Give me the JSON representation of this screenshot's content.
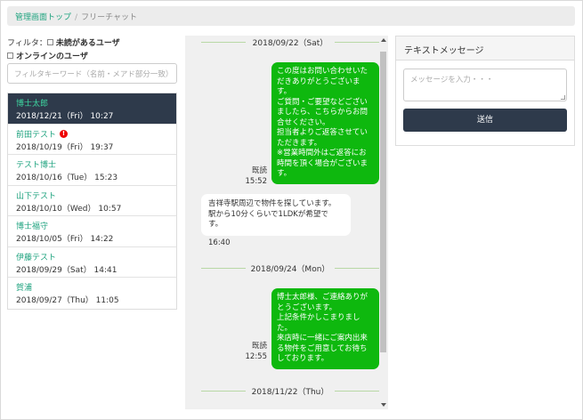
{
  "breadcrumb": {
    "home": "管理画面トップ",
    "separator": "/",
    "current": "フリーチャット"
  },
  "filter": {
    "label": "フィルタ：",
    "unread_label": "未読があるユーザ",
    "online_label": "オンラインのユーザ",
    "search_placeholder": "フィルタキーワード（名前・メアド部分一致）"
  },
  "users": [
    {
      "name": "博士太郎",
      "time": "2018/12/21（Fri） 10:27",
      "active": true,
      "unread": ""
    },
    {
      "name": "前田テスト",
      "time": "2018/10/19（Fri） 19:37",
      "active": false,
      "unread": "!"
    },
    {
      "name": "テスト博士",
      "time": "2018/10/16（Tue） 15:23",
      "active": false,
      "unread": ""
    },
    {
      "name": "山下テスト",
      "time": "2018/10/10（Wed） 10:57",
      "active": false,
      "unread": ""
    },
    {
      "name": "博士福守",
      "time": "2018/10/05（Fri） 14:22",
      "active": false,
      "unread": ""
    },
    {
      "name": "伊藤テスト",
      "time": "2018/09/29（Sat） 14:41",
      "active": false,
      "unread": ""
    },
    {
      "name": "賀浦",
      "time": "2018/09/27（Thu） 11:05",
      "active": false,
      "unread": ""
    }
  ],
  "chat": {
    "date1": "2018/09/22（Sat）",
    "msg1": {
      "lines": [
        "この度はお問い合わせいた",
        "だきありがとうございま",
        "す。",
        "ご質問・ご要望などござい",
        "ましたら、こちらからお問",
        "合せください。",
        "担当者よりご返答させてい",
        "ただきます。",
        "※営業時間外はご返答にお",
        "時間を頂く場合がございま",
        "す。"
      ],
      "read": "既読",
      "time": "15:52"
    },
    "msg2": {
      "lines": [
        "吉祥寺駅周辺で物件を探しています。",
        "駅から10分くらいで1LDKが希望で",
        "す。"
      ],
      "time": "16:40"
    },
    "date2": "2018/09/24（Mon）",
    "msg3": {
      "lines": [
        "博士太郎様、ご連絡ありが",
        "とうございます。",
        "上記条件かしこまりまし",
        "た。",
        "来店時に一緒にご案内出来",
        "る物件をご用意してお待ち",
        "しております。"
      ],
      "read": "既読",
      "time": "12:55"
    },
    "date3": "2018/11/22（Thu）"
  },
  "message_panel": {
    "title": "テキストメッセージ",
    "placeholder": "メッセージを入力・・・",
    "send_label": "送信"
  },
  "colors": {
    "accent": "#1fa37f",
    "dark_navy": "#2e3a4b",
    "bubble_green": "#0eb80e",
    "unread_red": "#e00000"
  }
}
